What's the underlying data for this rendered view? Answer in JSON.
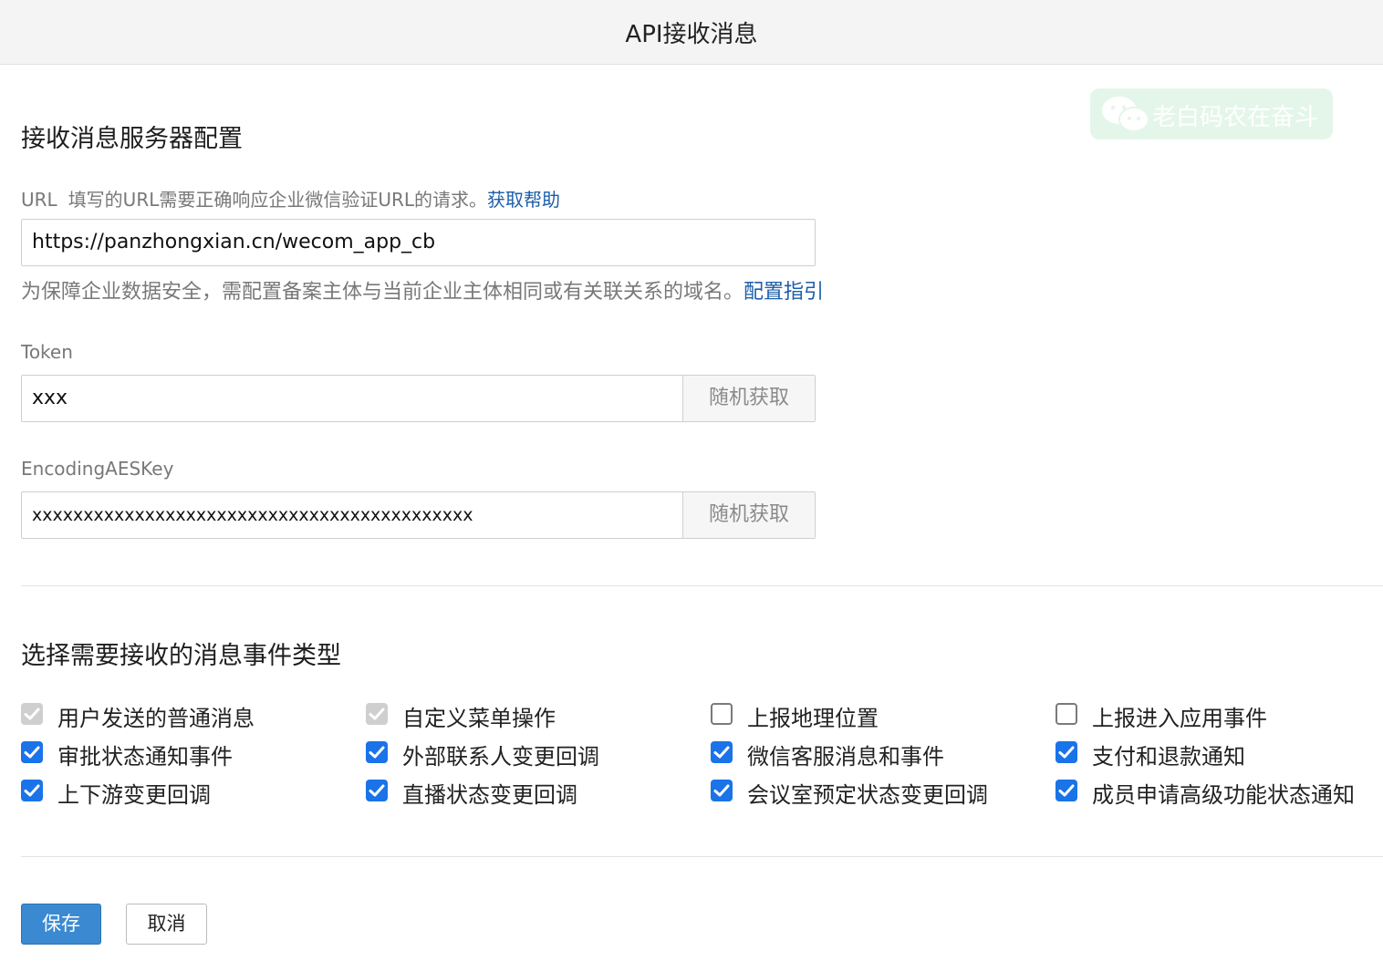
{
  "window": {
    "title": "API接收消息"
  },
  "watermark": {
    "text": "老白码农在奋斗"
  },
  "server_config": {
    "title": "接收消息服务器配置",
    "url": {
      "label": "URL",
      "hint": "填写的URL需要正确响应企业微信验证URL的请求。",
      "help_link": "获取帮助",
      "value": "https://panzhongxian.cn/wecom_app_cb",
      "note": "为保障企业数据安全，需配置备案主体与当前企业主体相同或有关联关系的域名。",
      "note_link": "配置指引"
    },
    "token": {
      "label": "Token",
      "value": "xxx",
      "random_label": "随机获取"
    },
    "aes_key": {
      "label": "EncodingAESKey",
      "value": "xxxxxxxxxxxxxxxxxxxxxxxxxxxxxxxxxxxxxxxxxxx",
      "random_label": "随机获取"
    }
  },
  "events": {
    "title": "选择需要接收的消息事件类型",
    "items": [
      {
        "label": "用户发送的普通消息",
        "state": "checked-disabled"
      },
      {
        "label": "自定义菜单操作",
        "state": "checked-disabled"
      },
      {
        "label": "上报地理位置",
        "state": "unchecked"
      },
      {
        "label": "上报进入应用事件",
        "state": "unchecked"
      },
      {
        "label": "审批状态通知事件",
        "state": "checked"
      },
      {
        "label": "外部联系人变更回调",
        "state": "checked"
      },
      {
        "label": "微信客服消息和事件",
        "state": "checked"
      },
      {
        "label": "支付和退款通知",
        "state": "checked"
      },
      {
        "label": "上下游变更回调",
        "state": "checked"
      },
      {
        "label": "直播状态变更回调",
        "state": "checked"
      },
      {
        "label": "会议室预定状态变更回调",
        "state": "checked"
      },
      {
        "label": "成员申请高级功能状态通知",
        "state": "checked"
      }
    ]
  },
  "actions": {
    "save_label": "保存",
    "cancel_label": "取消"
  },
  "colors": {
    "accent": "#1a73e8",
    "link": "#1d5ea8",
    "save_button": "#3b8ad1"
  }
}
